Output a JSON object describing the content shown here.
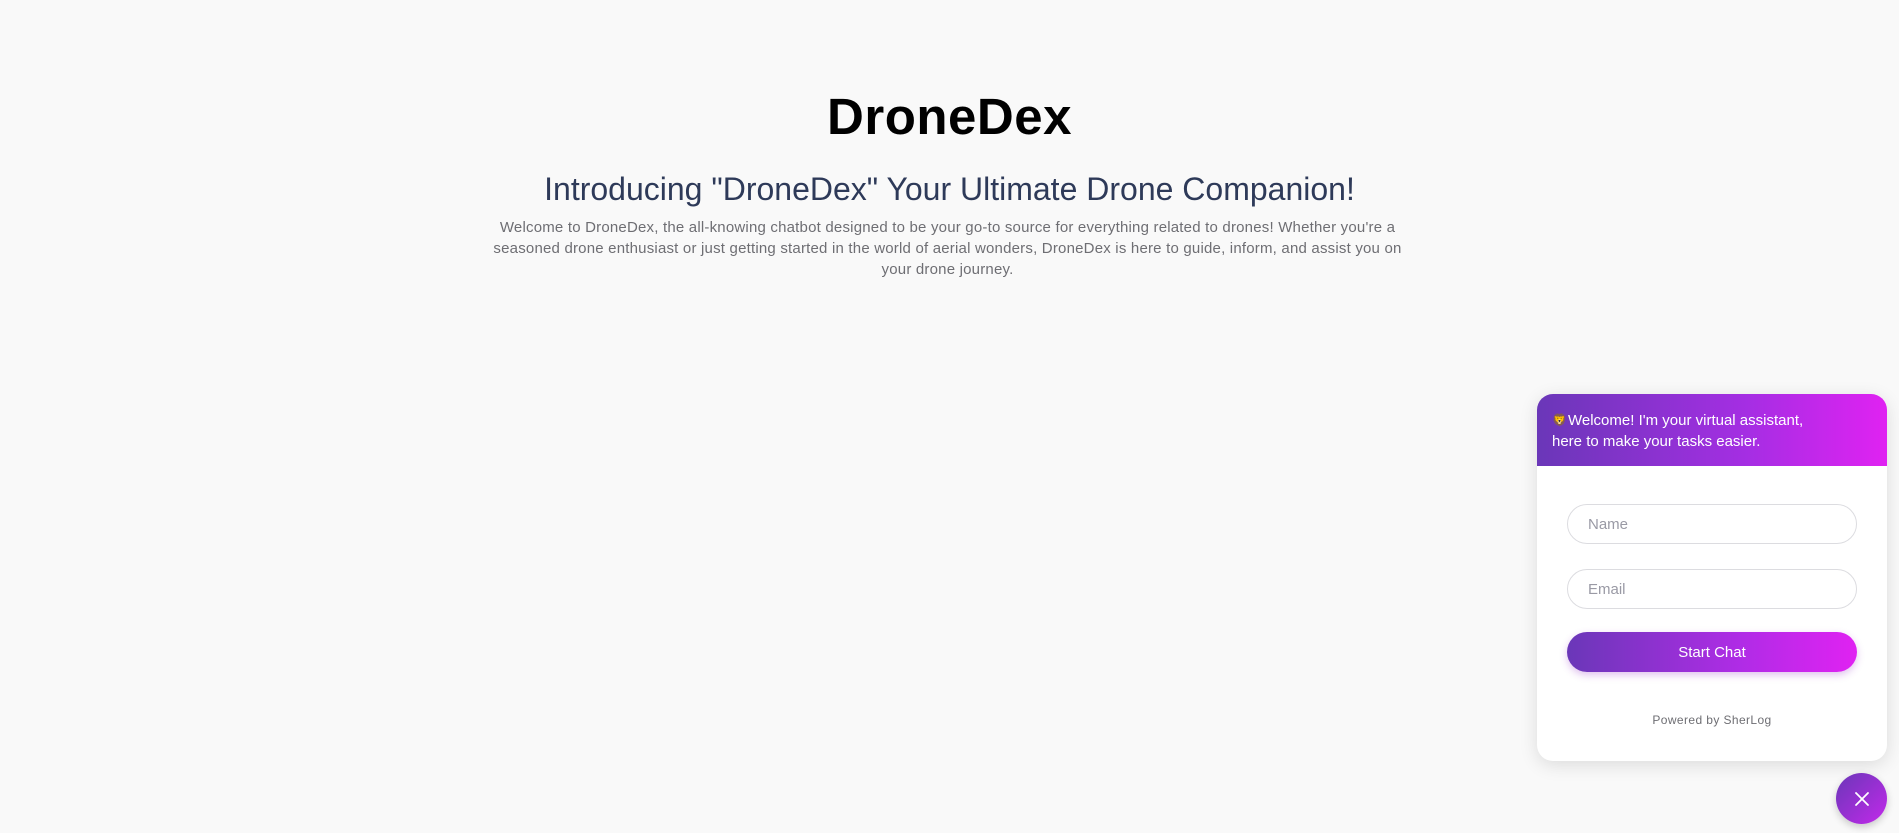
{
  "hero": {
    "brand": "DroneDex",
    "headline": "Introducing \"DroneDex\" Your Ultimate Drone Companion!",
    "intro": "Welcome to DroneDex, the all-knowing chatbot designed to be your go-to source for everything related to drones! Whether you're a seasoned drone enthusiast or just getting started in the world of aerial wonders, DroneDex is here to guide, inform, and assist you on your drone journey."
  },
  "chat": {
    "header_emoji": "🦁",
    "greeting": "Welcome! I'm your virtual assistant,\nhere to make your tasks easier.",
    "name_placeholder": "Name",
    "email_placeholder": "Email",
    "start_label": "Start Chat",
    "powered_by": "Powered by SherLog",
    "close_icon": "close-icon"
  },
  "colors": {
    "background": "#f9f9f9",
    "brand_text": "#000000",
    "headline_text": "#2e3a59",
    "body_text": "#6e6e73",
    "gradient_start": "#6a37b8",
    "gradient_end": "#e022f2"
  }
}
